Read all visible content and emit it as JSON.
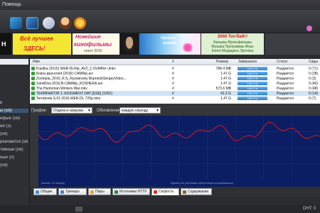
{
  "menu": {
    "help_label": "Помощь"
  },
  "banners": {
    "left_fragment": "H",
    "promo1": {
      "line1": "Всё лучшее",
      "line2": "ЗДЕСЬ!"
    },
    "promo2": {
      "line1": "Новейшие",
      "line2": "кинофильмы",
      "line3": "сезон 2016"
    },
    "promo3": {
      "line1": "Прогноз",
      "line2": "погоды"
    },
    "promo4": {
      "line1": "2000 Torrбайт!",
      "line2": "Фильмы  Мультфильмы",
      "line3": "Музыка  Программы  Игры",
      "line4": "Книги  Медицина  Эротика"
    }
  },
  "left_panel": {
    "items": [
      {
        "label": "в",
        "highlight": false
      },
      {
        "label": "ы (58)",
        "highlight": true
      },
      {
        "label": "ифые (58)",
        "highlight": false
      },
      {
        "label": "ия (3)",
        "highlight": false
      },
      {
        "label": "(58)",
        "highlight": false
      },
      {
        "label": "ркачаются (58)",
        "highlight": false
      },
      {
        "label": "тивные (58)",
        "highlight": false
      },
      {
        "label": "ные (0)",
        "highlight": false
      },
      {
        "label": "(58)",
        "highlight": false
      }
    ]
  },
  "list": {
    "headers": {
      "name": "Имя",
      "hash": "#",
      "size": "Размер",
      "done": "Завершено",
      "status": "Статус",
      "seeds": "Сиды"
    },
    "rows": [
      {
        "name": "Kopilka (2015) WEB-DLRip_AVC_[~DoMiNo~]mkv",
        "hash": "#",
        "size": "788.4 MB",
        "done": "100.0 %",
        "status": "Раздается",
        "seeds": "0 (71)",
        "selected": false
      },
      {
        "name": "Книга джунглей (2016) CAMRip.avi",
        "hash": "#",
        "size": "1.47 G",
        "done": "100.0 %",
        "status": "Раздается",
        "seeds": "0 (28)",
        "selected": false
      },
      {
        "name": "Zootopia_2016_R.S_Ryzalevsky BoponobSergeyVideo...",
        "hash": "#",
        "size": "1.47 G",
        "done": "100.0 %",
        "status": "Раздается",
        "seeds": "0 (3)",
        "selected": false
      },
      {
        "name": "XardtDes.2016.B.CAMRip_KOSHERA.avi",
        "hash": "#",
        "size": "1.47 G",
        "done": "100.0 %",
        "status": "Раздается",
        "seeds": "0 (40)",
        "selected": false
      },
      {
        "name": "The.Huntsman.Winters.War.mkv",
        "hash": "#",
        "size": "573.6 MB",
        "done": "100.0 %",
        "status": "Раздается",
        "seeds": "0 (48)",
        "selected": false
      },
      {
        "name": "TERMINATOR 2 JUDGMENT DAY [ESE] (1991)",
        "hash": "#",
        "size": "42.3 G",
        "done": "100.0 %",
        "status": "Раздается",
        "seeds": "0 (14)",
        "selected": true
      },
      {
        "name": "Terreboek.S.01.2016.WEB-DL.720p.mkv",
        "hash": "#",
        "size": "1.47 G",
        "done": "100.0 %",
        "status": "Раздается",
        "seeds": "0 (7)",
        "selected": false
      }
    ]
  },
  "graph": {
    "graph_label": "График:",
    "graph_select": "Отдача и загрузка",
    "refresh_label": "Обновление:",
    "refresh_select": "каждую секунду",
    "step_label": "Шкала: 10 секунд",
    "time_label": "Время (не учитывая полученную информацию)",
    "line_color": "#d81a1a",
    "bg_color": "#0b1d63"
  },
  "tabs": [
    {
      "label": "Общие",
      "active": false,
      "color": "#4a90d9"
    },
    {
      "label": "Трекеры",
      "active": false,
      "color": "#3a8bd6"
    },
    {
      "label": "Пиры",
      "active": false,
      "color": "#f0a030"
    },
    {
      "label": "Источники HTTP",
      "active": false,
      "color": "#2e8b3a"
    },
    {
      "label": "Скорость",
      "active": true,
      "color": "#d23a2a"
    },
    {
      "label": "Содержание",
      "active": false,
      "color": "#8a6a2a"
    }
  ],
  "status": {
    "right_text": "DHT: 0"
  }
}
